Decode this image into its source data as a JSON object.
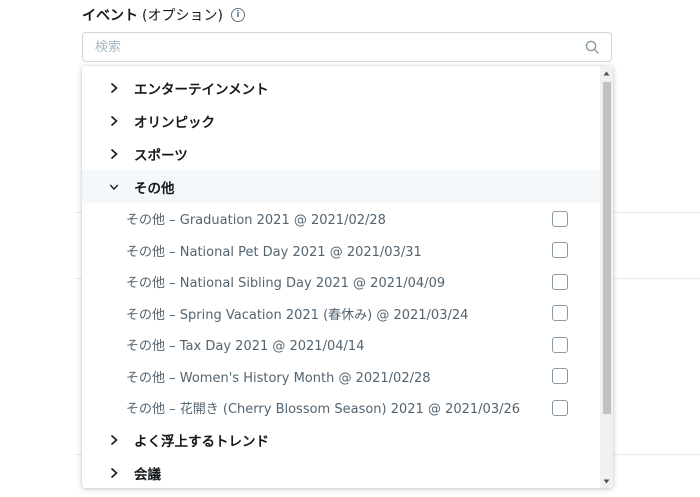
{
  "header": {
    "label": "イベント",
    "optional": "(オプション)",
    "info_icon": "info-icon"
  },
  "search": {
    "placeholder": "検索",
    "icon": "search-icon"
  },
  "dropdown": {
    "categories_before": [
      {
        "label": "エンターテインメント",
        "expanded": false
      },
      {
        "label": "オリンピック",
        "expanded": false
      },
      {
        "label": "スポーツ",
        "expanded": false
      }
    ],
    "expanded_category": {
      "label": "その他",
      "items": [
        {
          "label": "その他 – Graduation 2021 @ 2021/02/28",
          "checked": false
        },
        {
          "label": "その他 – National Pet Day 2021 @ 2021/03/31",
          "checked": false
        },
        {
          "label": "その他 – National Sibling Day 2021 @ 2021/04/09",
          "checked": false
        },
        {
          "label": "その他 – Spring Vacation 2021 (春休み) @ 2021/03/24",
          "checked": false
        },
        {
          "label": "その他 – Tax Day 2021 @ 2021/04/14",
          "checked": false
        },
        {
          "label": "その他 – Women's History Month @ 2021/02/28",
          "checked": false
        },
        {
          "label": "その他 – 花開き (Cherry Blossom Season) 2021 @ 2021/03/26",
          "checked": false
        }
      ]
    },
    "categories_after": [
      {
        "label": "よく浮上するトレンド",
        "expanded": false
      },
      {
        "label": "会議",
        "expanded": false
      }
    ]
  },
  "colors": {
    "text": "#14171a",
    "muted": "#536471",
    "border": "#ccd6dd",
    "checkbox_border": "#8899a6",
    "expanded_bg": "#f5f8fa"
  }
}
